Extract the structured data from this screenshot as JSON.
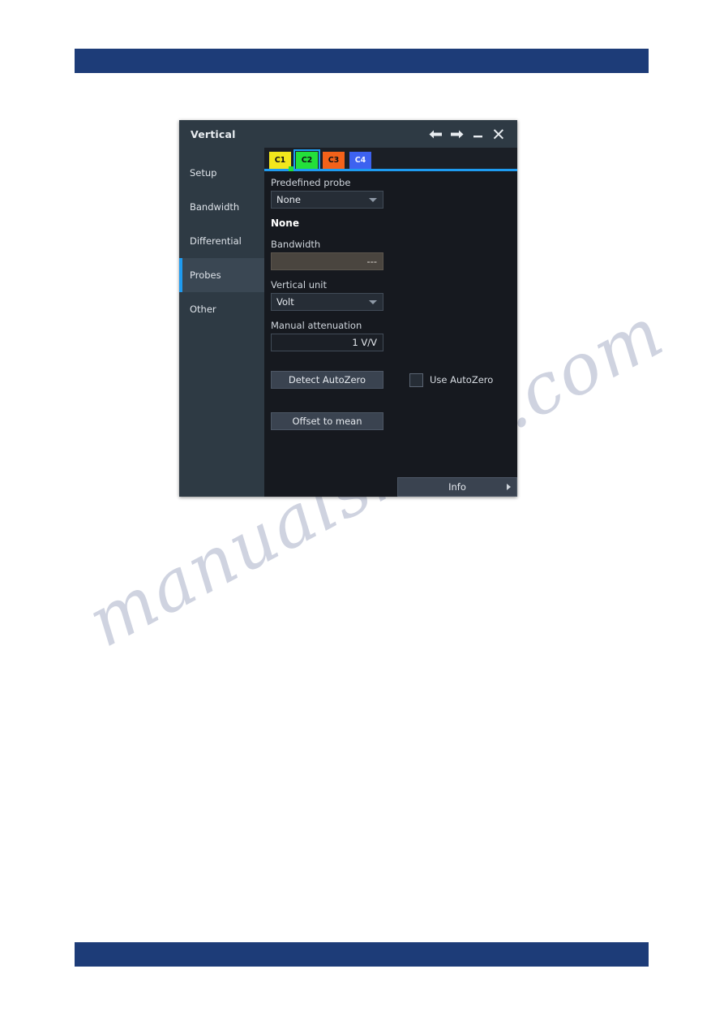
{
  "page": {
    "header_band_color": "#1d3c78",
    "footer_band_color": "#1d3c78",
    "watermark_text": "manualshive.com"
  },
  "dialog": {
    "title": "Vertical",
    "titlebar_icons": [
      {
        "name": "back-arrow-icon",
        "glyph": "←"
      },
      {
        "name": "forward-arrow-icon",
        "glyph": "→"
      },
      {
        "name": "minimize-icon",
        "glyph": "—"
      },
      {
        "name": "close-icon",
        "glyph": "✕"
      }
    ],
    "sidebar": {
      "items": [
        {
          "label": "Setup",
          "selected": false
        },
        {
          "label": "Bandwidth",
          "selected": false
        },
        {
          "label": "Differential",
          "selected": false
        },
        {
          "label": "Probes",
          "selected": true
        },
        {
          "label": "Other",
          "selected": false
        }
      ],
      "selected_indicator_color": "#1e9bf0"
    },
    "channel_tabs": {
      "active": "C2",
      "accent_color": "#1e9bf0",
      "items": [
        {
          "label": "C1",
          "color": "#f2e71c",
          "active": false
        },
        {
          "label": "C2",
          "color": "#23e03a",
          "active": true
        },
        {
          "label": "C3",
          "color": "#f4621a",
          "active": false
        },
        {
          "label": "C4",
          "color": "#3d62f0",
          "active": false
        }
      ]
    },
    "form": {
      "predefined_probe_label": "Predefined probe",
      "predefined_probe_value": "None",
      "probe_name_value": "None",
      "bandwidth_label": "Bandwidth",
      "bandwidth_value": "---",
      "vertical_unit_label": "Vertical unit",
      "vertical_unit_value": "Volt",
      "manual_attenuation_label": "Manual attenuation",
      "manual_attenuation_value": "1 V/V",
      "detect_autozero_label": "Detect AutoZero",
      "use_autozero_label": "Use AutoZero",
      "use_autozero_checked": false,
      "offset_to_mean_label": "Offset to mean",
      "info_label": "Info"
    }
  }
}
